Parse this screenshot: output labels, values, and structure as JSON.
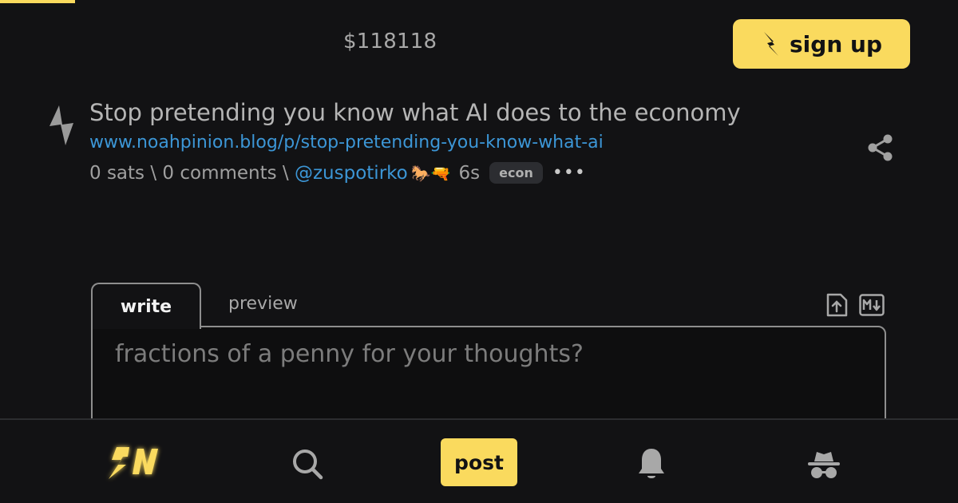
{
  "header": {
    "price": "$118118",
    "signup_label": "sign up"
  },
  "item": {
    "title": "Stop pretending you know what AI does to the economy",
    "link": "www.noahpinion.blog/p/stop-pretending-you-know-what-ai",
    "sats": "0 sats",
    "sep1": " \\ ",
    "comments": "0 comments",
    "sep2": " \\ ",
    "user": "@zuspotirko",
    "badges": "🐎🔫",
    "age": "6s",
    "tag": "econ",
    "more": "•••"
  },
  "editor": {
    "tab_write": "write",
    "tab_preview": "preview",
    "placeholder": "fractions of a penny for your thoughts?"
  },
  "bottom_nav": {
    "post_label": "post",
    "icons": [
      "sn-logo-icon",
      "search-icon",
      "bell-icon",
      "incognito-icon"
    ]
  },
  "colors": {
    "accent": "#fada5e",
    "link": "#3c96d6",
    "background": "#121214"
  }
}
